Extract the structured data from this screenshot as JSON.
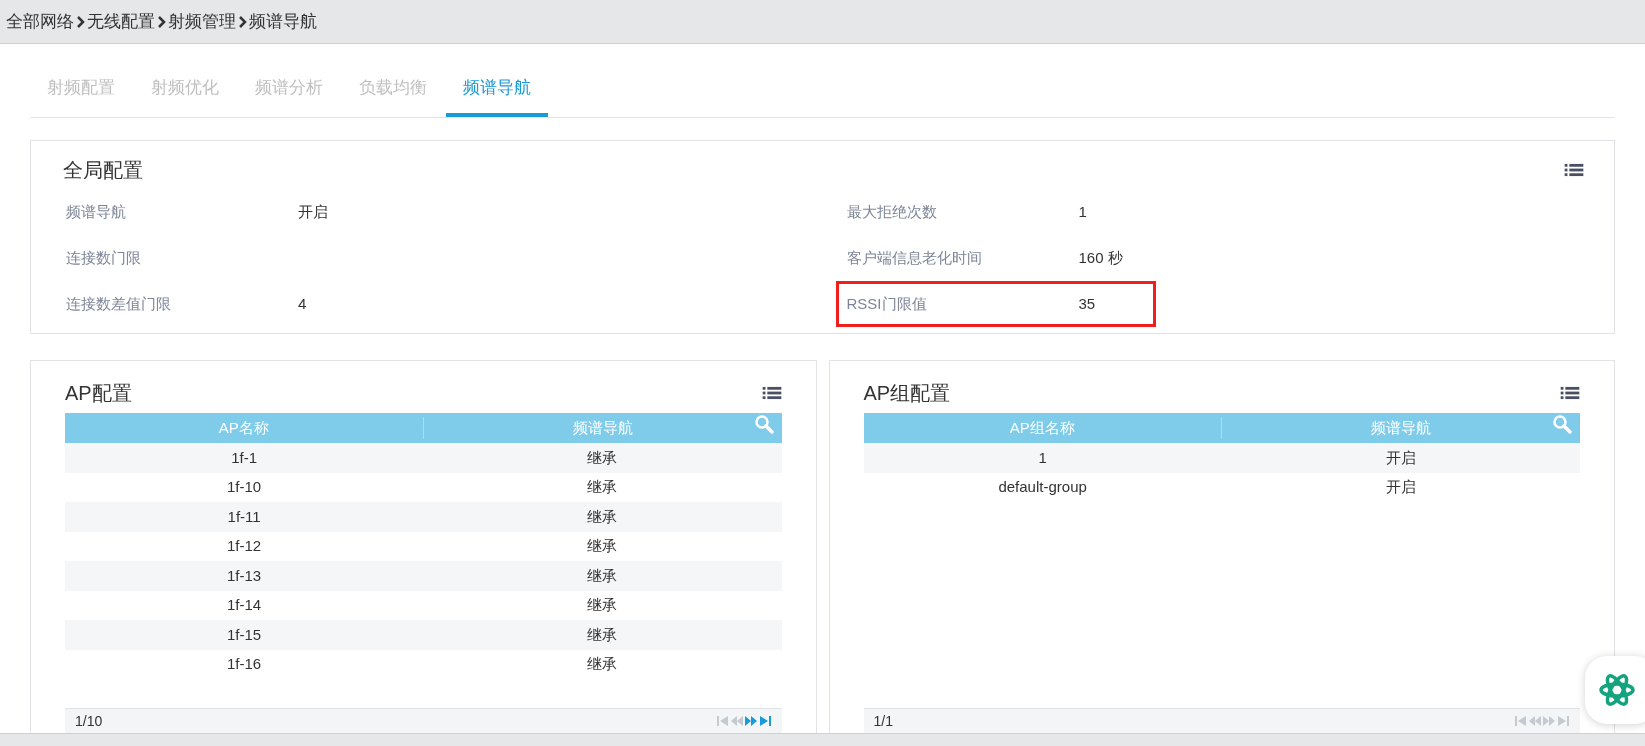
{
  "breadcrumb": [
    "全部网络",
    "无线配置",
    "射频管理",
    "频谱导航"
  ],
  "tabs": [
    {
      "label": "射频配置",
      "selected": false
    },
    {
      "label": "射频优化",
      "selected": false
    },
    {
      "label": "频谱分析",
      "selected": false
    },
    {
      "label": "负载均衡",
      "selected": false
    },
    {
      "label": "频谱导航",
      "selected": true
    }
  ],
  "global_config": {
    "title": "全局配置",
    "fields": [
      {
        "label": "频谱导航",
        "value": "开启",
        "highlighted": false
      },
      {
        "label": "最大拒绝次数",
        "value": "1",
        "highlighted": false
      },
      {
        "label": "连接数门限",
        "highlighted": false
      },
      {
        "label": "客户端信息老化时间",
        "value": "160 秒",
        "highlighted": false
      },
      {
        "label": "连接数差值门限",
        "value": "4",
        "highlighted": false
      },
      {
        "label": "RSSI门限值",
        "value": "35",
        "highlighted": true
      }
    ]
  },
  "panels": [
    {
      "title": "AP配置",
      "columns": [
        "AP名称",
        "频谱导航"
      ],
      "rows": [
        [
          "1f-1",
          "继承"
        ],
        [
          "1f-10",
          "继承"
        ],
        [
          "1f-11",
          "继承"
        ],
        [
          "1f-12",
          "继承"
        ],
        [
          "1f-13",
          "继承"
        ],
        [
          "1f-14",
          "继承"
        ],
        [
          "1f-15",
          "继承"
        ],
        [
          "1f-16",
          "继承"
        ]
      ],
      "pager": {
        "text": "1/10",
        "back_disabled": true,
        "forward_disabled": false
      }
    },
    {
      "title": "AP组配置",
      "columns": [
        "AP组名称",
        "频谱导航"
      ],
      "rows": [
        [
          "1",
          "开启"
        ],
        [
          "default-group",
          "开启"
        ]
      ],
      "pager": {
        "text": "1/1",
        "back_disabled": true,
        "forward_disabled": true
      }
    }
  ]
}
